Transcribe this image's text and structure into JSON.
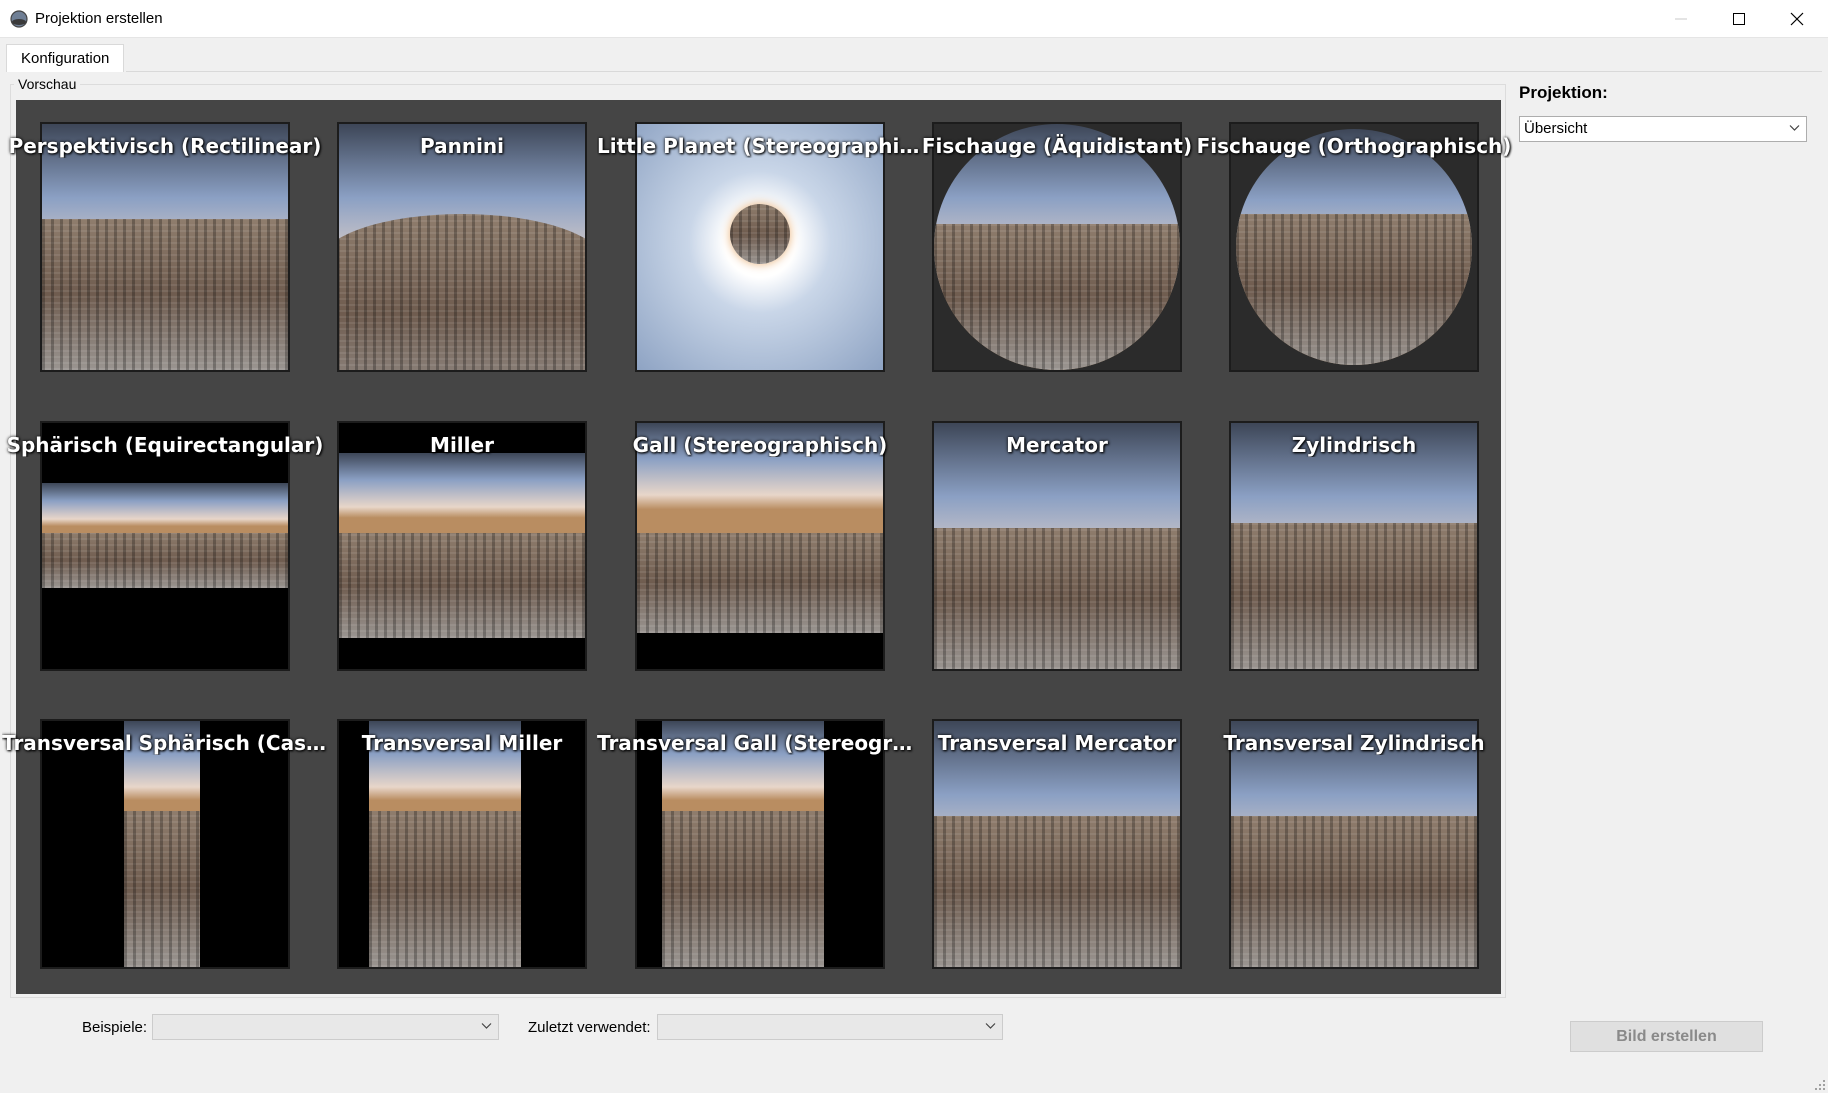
{
  "window": {
    "title": "Projektion erstellen"
  },
  "tabs": [
    {
      "label": "Konfiguration"
    }
  ],
  "preview": {
    "group_label": "Vorschau",
    "items": [
      {
        "label": "Perspektivisch (Rectilinear)",
        "style": "rectilinear"
      },
      {
        "label": "Pannini",
        "style": "pannini"
      },
      {
        "label": "Little Planet (Stereographis...",
        "style": "planet"
      },
      {
        "label": "Fischauge (Äquidistant)",
        "style": "fisheye"
      },
      {
        "label": "Fischauge (Orthographisch)",
        "style": "fisheye-ortho"
      },
      {
        "label": "Sphärisch (Equirectangular)",
        "style": "equirect"
      },
      {
        "label": "Miller",
        "style": "miller"
      },
      {
        "label": "Gall (Stereographisch)",
        "style": "gall"
      },
      {
        "label": "Mercator",
        "style": "mercator"
      },
      {
        "label": "Zylindrisch",
        "style": "cylindrical"
      },
      {
        "label": "Transversal Sphärisch (Cassini)",
        "style": "trans-narrow"
      },
      {
        "label": "Transversal Miller",
        "style": "trans-mid"
      },
      {
        "label": "Transversal Gall (Stereograp...",
        "style": "trans-wide"
      },
      {
        "label": "Transversal Mercator",
        "style": "trans-full"
      },
      {
        "label": "Transversal Zylindrisch",
        "style": "trans-full"
      }
    ]
  },
  "sidebar": {
    "projection_label": "Projektion:",
    "projection_value": "Übersicht"
  },
  "footer": {
    "examples_label": "Beispiele:",
    "examples_value": "",
    "recent_label": "Zuletzt verwendet:",
    "recent_value": "",
    "create_button": "Bild erstellen"
  },
  "icons": {
    "app": "app-globe-icon",
    "minimize": "minimize-icon",
    "maximize": "maximize-icon",
    "close": "close-icon",
    "dropdown": "chevron-down-icon"
  }
}
